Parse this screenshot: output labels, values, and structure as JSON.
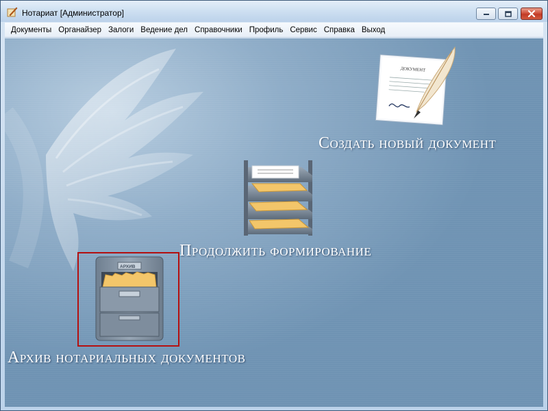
{
  "window": {
    "title": "Нотариат [Администратор]",
    "app_icon": "notary-pen-icon",
    "controls": [
      "minimize-icon",
      "maximize-icon",
      "close-icon"
    ]
  },
  "menu": {
    "items": [
      "Документы",
      "Органайзер",
      "Залоги",
      "Ведение дел",
      "Справочники",
      "Профиль",
      "Сервис",
      "Справка",
      "Выход"
    ]
  },
  "main": {
    "create_document": {
      "label": "Создать новый документ",
      "icon": "document-quill-icon",
      "doc_heading": "ДОКУМЕНТ"
    },
    "continue_forming": {
      "label": "Продолжить формирование",
      "icon": "paper-tray-icon"
    },
    "archive": {
      "label": "Архив нотариальных документов",
      "icon": "file-cabinet-icon",
      "cabinet_label": "АРХИВ"
    }
  },
  "colors": {
    "background": "#8fadc8",
    "label_text": "#ffffff",
    "selection_border": "#b40f0f"
  }
}
